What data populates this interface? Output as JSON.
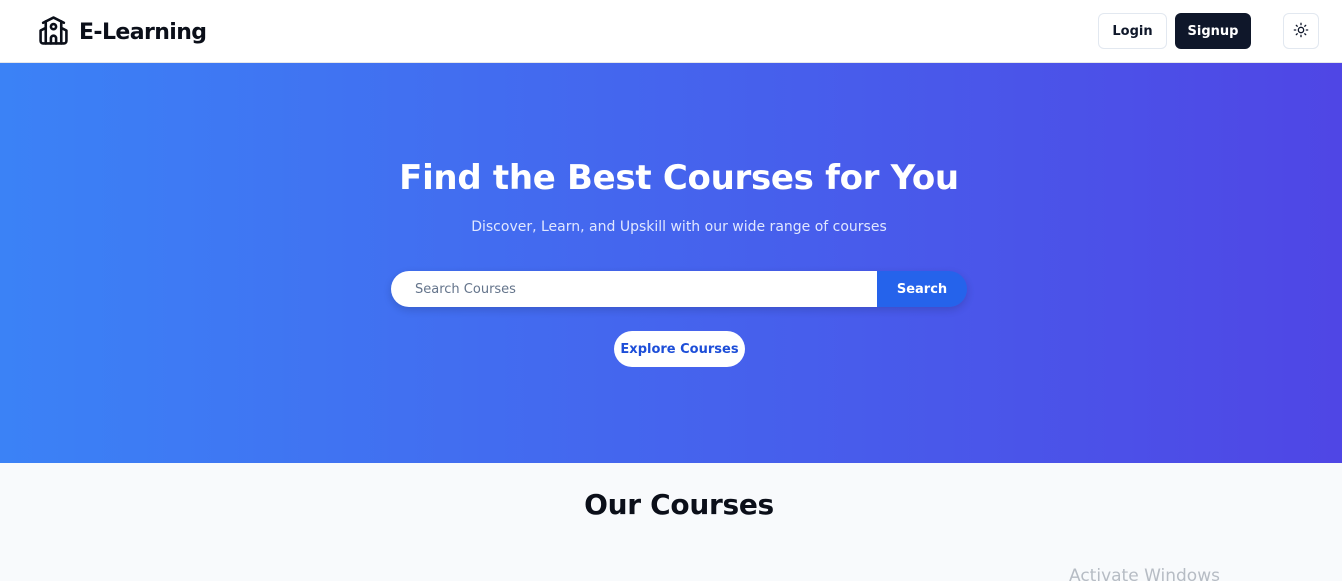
{
  "header": {
    "brand_icon": "school-icon",
    "brand_name": "E-Learning",
    "login_label": "Login",
    "signup_label": "Signup",
    "theme_toggle_icon": "sun-icon"
  },
  "hero": {
    "title": "Find the Best Courses for You",
    "subtitle": "Discover, Learn, and Upskill with our wide range of courses",
    "search": {
      "placeholder": "Search Courses",
      "value": "",
      "button_label": "Search"
    },
    "explore_label": "Explore Courses",
    "gradient_start": "#3b82f6",
    "gradient_end": "#4f46e5"
  },
  "courses": {
    "title": "Our Courses"
  },
  "os_watermark": "Activate Windows",
  "colors": {
    "signup_bg": "#0f172a",
    "search_button": "#2563eb",
    "explore_text": "#1d4ed8"
  }
}
